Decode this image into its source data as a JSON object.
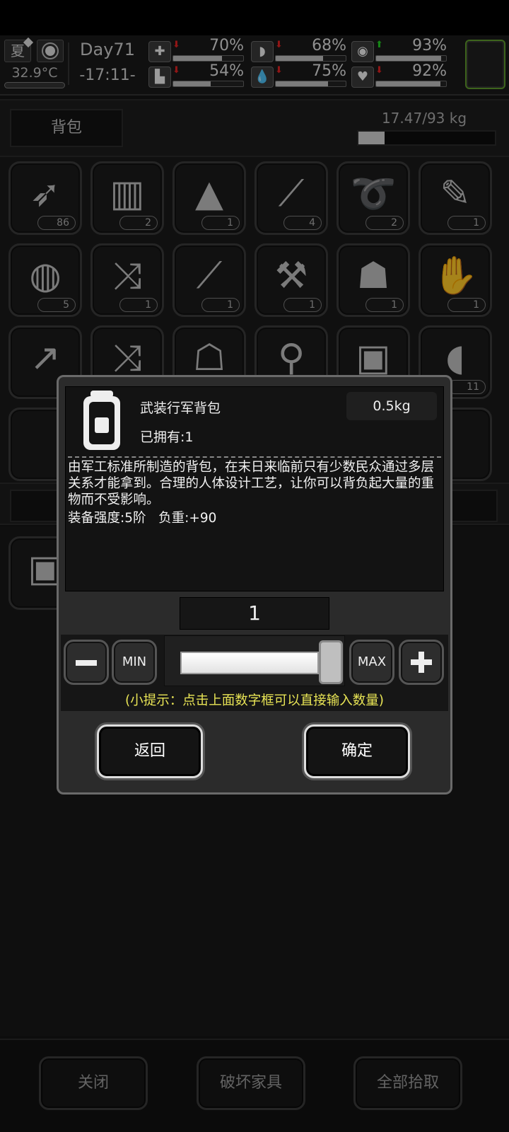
{
  "hud": {
    "season": "夏",
    "temperature": "32.9°C",
    "day": "Day71",
    "time": "-17:11-",
    "stats": [
      {
        "name": "health",
        "icon": "✚",
        "arrow": "down",
        "value": "70%",
        "level": 0.7
      },
      {
        "name": "hunger",
        "icon": "◗",
        "arrow": "down",
        "value": "68%",
        "level": 0.68
      },
      {
        "name": "spirit",
        "icon": "◉",
        "arrow": "up",
        "value": "93%",
        "level": 0.93
      },
      {
        "name": "stamina",
        "icon": "▙",
        "arrow": "down",
        "value": "54%",
        "level": 0.54
      },
      {
        "name": "thirst",
        "icon": "💧",
        "arrow": "down",
        "value": "75%",
        "level": 0.75
      },
      {
        "name": "mood",
        "icon": "♥",
        "arrow": "down",
        "value": "92%",
        "level": 0.92
      }
    ]
  },
  "backpack": {
    "title": "背包",
    "weight": "17.47/93 kg",
    "weight_fraction": 0.19
  },
  "slots": [
    {
      "icon": "arrow-icon",
      "glyph": "➶",
      "count": "86"
    },
    {
      "icon": "towel-icon",
      "glyph": "▥",
      "count": "2"
    },
    {
      "icon": "cloth-icon",
      "glyph": "▲",
      "count": "1"
    },
    {
      "icon": "lockpick-icon",
      "glyph": "⟋",
      "count": "4"
    },
    {
      "icon": "rope-icon",
      "glyph": "➰",
      "count": "2"
    },
    {
      "icon": "syringe-icon",
      "glyph": "✎",
      "count": "1"
    },
    {
      "icon": "net-icon",
      "glyph": "◍",
      "count": "5"
    },
    {
      "icon": "crossbow-icon",
      "glyph": "⤨",
      "count": "1"
    },
    {
      "icon": "knife-icon",
      "glyph": "⟋",
      "count": "1"
    },
    {
      "icon": "axe-icon",
      "glyph": "⚒",
      "count": "1"
    },
    {
      "icon": "hat-icon",
      "glyph": "☗",
      "count": "1"
    },
    {
      "icon": "gloves-icon",
      "glyph": "✋",
      "count": "1"
    },
    {
      "icon": "spear-icon",
      "glyph": "↗",
      "count": ""
    },
    {
      "icon": "crossbow2-icon",
      "glyph": "⤨",
      "count": ""
    },
    {
      "icon": "hood-icon",
      "glyph": "☖",
      "count": ""
    },
    {
      "icon": "shovel-icon",
      "glyph": "⚲",
      "count": ""
    },
    {
      "icon": "backpack-icon",
      "glyph": "▣",
      "count": ""
    },
    {
      "icon": "meat-icon",
      "glyph": "◖",
      "count": "11"
    }
  ],
  "bottom_buttons": {
    "close": "关闭",
    "destroy": "破坏家具",
    "pickup_all": "全部拾取"
  },
  "dialog": {
    "item_name": "武装行军背包",
    "item_weight": "0.5kg",
    "owned": "已拥有:1",
    "description": "由军工标准所制造的背包，在末日来临前只有少数民众通过多层关系才能拿到。合理的人体设计工艺，让你可以背负起大量的重物而不受影响。",
    "stats": "装备强度:5阶   负重:+90",
    "quantity": "1",
    "slider_fraction": 1.0,
    "min_label": "MIN",
    "max_label": "MAX",
    "hint": "(小提示：点击上面数字框可以直接输入数量)",
    "back_label": "返回",
    "confirm_label": "确定"
  }
}
